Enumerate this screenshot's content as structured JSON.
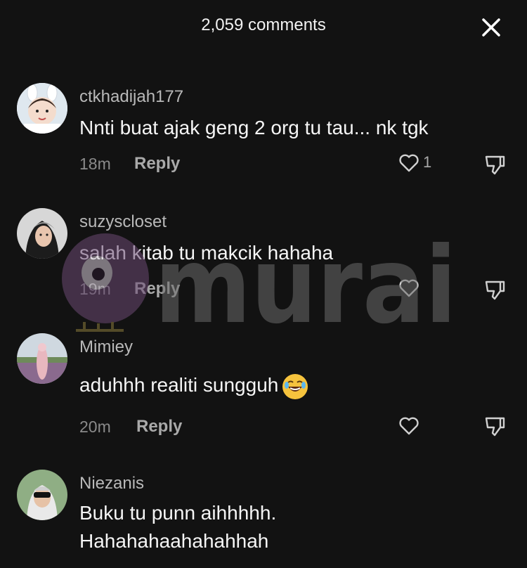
{
  "header": {
    "title": "2,059 comments"
  },
  "comments": [
    {
      "username": "ctkhadijah177",
      "text": "Nnti buat ajak geng 2 org tu tau... nk tgk",
      "time": "18m",
      "reply": "Reply",
      "likes": "1"
    },
    {
      "username": "suzyscloset",
      "text": "salah kitab tu makcik hahaha",
      "time": "19m",
      "reply": "Reply",
      "likes": ""
    },
    {
      "username": "Mimiey",
      "text": "aduhhh realiti sungguh",
      "emoji": "face-with-tears-of-joy",
      "time": "20m",
      "reply": "Reply",
      "likes": ""
    },
    {
      "username": "Niezanis",
      "text_line1": "Buku tu punn aihhhhh.",
      "text_line2": "Hahahahaahahahhah"
    }
  ],
  "watermark": {
    "text": "murai"
  },
  "colors": {
    "background": "#121212",
    "username": "#b9b9b9",
    "meta": "#8a8a8a",
    "watermark": "#6b4a73"
  }
}
